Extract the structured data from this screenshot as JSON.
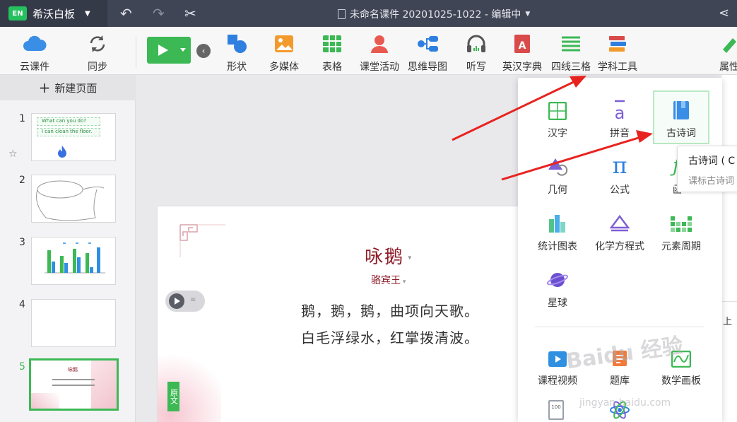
{
  "titlebar": {
    "logo": "EN",
    "app_name": "希沃白板",
    "document_title": "未命名课件 20201025-1022 - 编辑中"
  },
  "toolbar": {
    "left_tools": [
      {
        "label": "云课件",
        "icon": "cloud-icon"
      },
      {
        "label": "同步",
        "icon": "sync-icon"
      }
    ],
    "insert_tools": [
      {
        "label": "形状",
        "icon": "shape-icon"
      },
      {
        "label": "多媒体",
        "icon": "media-icon"
      },
      {
        "label": "表格",
        "icon": "table-icon"
      },
      {
        "label": "课堂活动",
        "icon": "activity-icon"
      },
      {
        "label": "思维导图",
        "icon": "mindmap-icon"
      },
      {
        "label": "听写",
        "icon": "headphones-icon"
      },
      {
        "label": "英汉字典",
        "icon": "dictionary-icon"
      },
      {
        "label": "四线三格",
        "icon": "four-line-icon"
      },
      {
        "label": "学科工具",
        "icon": "subject-tools-icon"
      }
    ],
    "right_tool": {
      "label": "属性",
      "icon": "properties-icon"
    }
  },
  "sidebar": {
    "new_page_label": "新建页面",
    "slides": [
      {
        "number": "1",
        "line1": "What can you do?",
        "line2": "I can clean the floor."
      },
      {
        "number": "2"
      },
      {
        "number": "3"
      },
      {
        "number": "4"
      },
      {
        "number": "5",
        "active": true
      }
    ]
  },
  "slide": {
    "title": "咏鹅",
    "author": "骆宾王",
    "lines": [
      "鹅，鹅，鹅，曲项向天歌。",
      "白毛浮绿水，红掌拨清波。"
    ],
    "side_tab": "原文"
  },
  "subject_tools_menu": {
    "items": [
      {
        "label": "汉字",
        "icon": "hanzi-grid-icon"
      },
      {
        "label": "拼音",
        "icon": "pinyin-icon"
      },
      {
        "label": "古诗词",
        "icon": "book-icon",
        "selected": true
      },
      {
        "label": "几何",
        "icon": "geometry-icon"
      },
      {
        "label": "公式",
        "icon": "pi-icon"
      },
      {
        "label": "函",
        "icon": "function-icon"
      },
      {
        "label": "统计图表",
        "icon": "bar-chart-icon"
      },
      {
        "label": "化学方程式",
        "icon": "chemistry-icon"
      },
      {
        "label": "元素周期",
        "icon": "periodic-table-icon"
      },
      {
        "label": "星球",
        "icon": "planet-icon"
      },
      {
        "label": "课程视频",
        "icon": "video-icon"
      },
      {
        "label": "题库",
        "icon": "question-bank-icon"
      },
      {
        "label": "数学画板",
        "icon": "math-board-icon"
      }
    ]
  },
  "tooltip": {
    "title": "古诗词 ( C",
    "description": "课标古诗词"
  },
  "right_panel": {
    "item": "上"
  },
  "watermark": {
    "brand": "Baidu 经验",
    "url": "jingyan.baidu.com"
  },
  "colors": {
    "accent_green": "#3cb954",
    "titlebar_bg": "#404556",
    "poem_red": "#8e1c28",
    "arrow_red": "#e8231f"
  }
}
